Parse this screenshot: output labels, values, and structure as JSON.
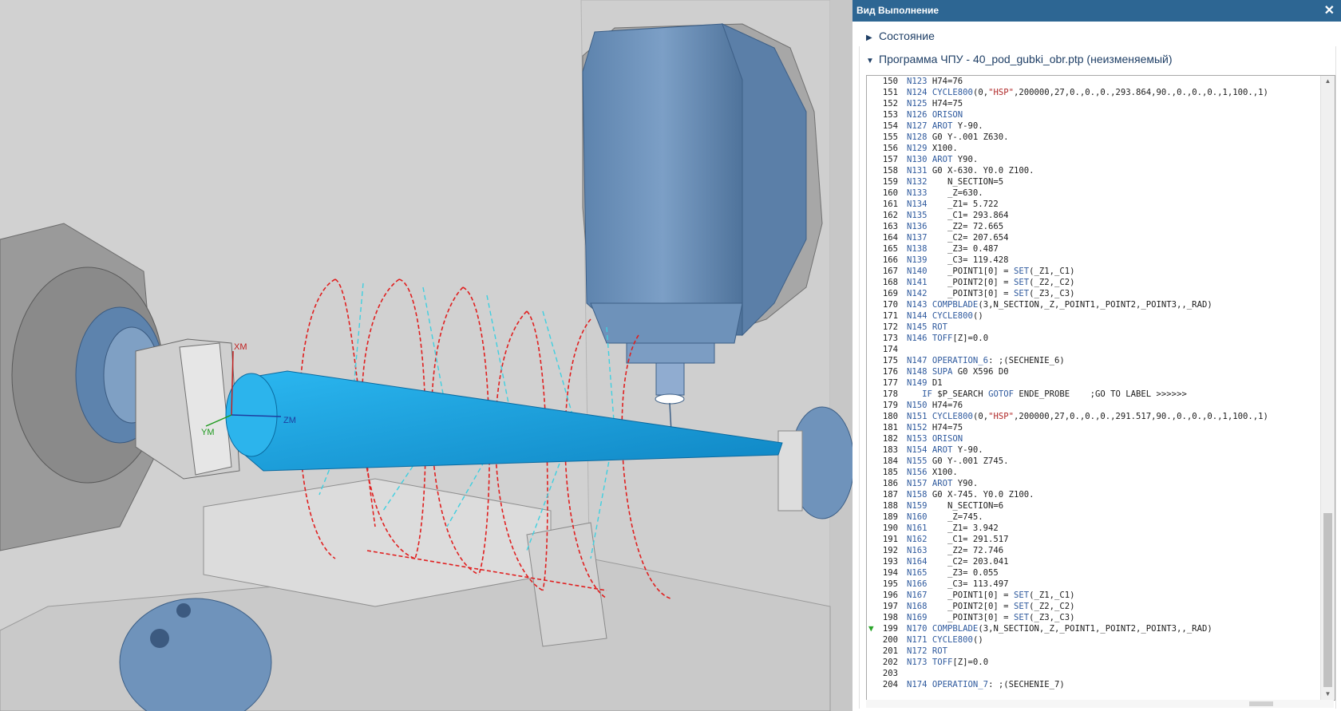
{
  "panel": {
    "title": "Вид Выполнение",
    "close_glyph": "✕",
    "sections": [
      {
        "label": "Состояние",
        "expanded": false
      },
      {
        "label": "Программа ЧПУ - 40_pod_gubki_obr.ptp (неизменяемый)",
        "expanded": true
      }
    ],
    "current_line": "199"
  },
  "viewport": {
    "labels": {
      "xm": "XM",
      "ym": "YM",
      "zm": "ZM"
    }
  },
  "icons": [
    "close-icon",
    "chevron-right-icon",
    "chevron-down-icon",
    "current-line-arrow-icon",
    "scroll-up-icon",
    "scroll-down-icon"
  ],
  "colors": {
    "title_bar": "#2d6693",
    "part": "#1aa3e0",
    "toolpath_red": "#e02020",
    "toolpath_cyan": "#3fd0e0",
    "machine_blue": "#6f93bb"
  },
  "code": [
    {
      "n": "150",
      "text": "N123 H74=76"
    },
    {
      "n": "151",
      "text": "N124 CYCLE800(0,\"HSP\",200000,27,0.,0.,0.,293.864,90.,0.,0.,0.,1,100.,1)"
    },
    {
      "n": "152",
      "text": "N125 H74=75"
    },
    {
      "n": "153",
      "text": "N126 ORISON"
    },
    {
      "n": "154",
      "text": "N127 AROT Y-90."
    },
    {
      "n": "155",
      "text": "N128 G0 Y-.001 Z630."
    },
    {
      "n": "156",
      "text": "N129 X100."
    },
    {
      "n": "157",
      "text": "N130 AROT Y90."
    },
    {
      "n": "158",
      "text": "N131 G0 X-630. Y0.0 Z100."
    },
    {
      "n": "159",
      "text": "N132    N_SECTION=5"
    },
    {
      "n": "160",
      "text": "N133    _Z=630."
    },
    {
      "n": "161",
      "text": "N134    _Z1= 5.722"
    },
    {
      "n": "162",
      "text": "N135    _C1= 293.864"
    },
    {
      "n": "163",
      "text": "N136    _Z2= 72.665"
    },
    {
      "n": "164",
      "text": "N137    _C2= 207.654"
    },
    {
      "n": "165",
      "text": "N138    _Z3= 0.487"
    },
    {
      "n": "166",
      "text": "N139    _C3= 119.428"
    },
    {
      "n": "167",
      "text": "N140    _POINT1[0] = SET(_Z1,_C1)"
    },
    {
      "n": "168",
      "text": "N141    _POINT2[0] = SET(_Z2,_C2)"
    },
    {
      "n": "169",
      "text": "N142    _POINT3[0] = SET(_Z3,_C3)"
    },
    {
      "n": "170",
      "text": "N143 COMPBLADE(3,N_SECTION,_Z,_POINT1,_POINT2,_POINT3,,_RAD)"
    },
    {
      "n": "171",
      "text": "N144 CYCLE800()"
    },
    {
      "n": "172",
      "text": "N145 ROT"
    },
    {
      "n": "173",
      "text": "N146 TOFF[Z]=0.0"
    },
    {
      "n": "174",
      "text": ""
    },
    {
      "n": "175",
      "text": "N147 OPERATION_6: ;(SECHENIE_6)"
    },
    {
      "n": "176",
      "text": "N148 SUPA G0 X596 D0"
    },
    {
      "n": "177",
      "text": "N149 D1"
    },
    {
      "n": "178",
      "text": "   IF $P_SEARCH GOTOF ENDE_PROBE    ;GO TO LABEL >>>>>>"
    },
    {
      "n": "179",
      "text": "N150 H74=76"
    },
    {
      "n": "180",
      "text": "N151 CYCLE800(0,\"HSP\",200000,27,0.,0.,0.,291.517,90.,0.,0.,0.,1,100.,1)"
    },
    {
      "n": "181",
      "text": "N152 H74=75"
    },
    {
      "n": "182",
      "text": "N153 ORISON"
    },
    {
      "n": "183",
      "text": "N154 AROT Y-90."
    },
    {
      "n": "184",
      "text": "N155 G0 Y-.001 Z745."
    },
    {
      "n": "185",
      "text": "N156 X100."
    },
    {
      "n": "186",
      "text": "N157 AROT Y90."
    },
    {
      "n": "187",
      "text": "N158 G0 X-745. Y0.0 Z100."
    },
    {
      "n": "188",
      "text": "N159    N_SECTION=6"
    },
    {
      "n": "189",
      "text": "N160    _Z=745."
    },
    {
      "n": "190",
      "text": "N161    _Z1= 3.942"
    },
    {
      "n": "191",
      "text": "N162    _C1= 291.517"
    },
    {
      "n": "192",
      "text": "N163    _Z2= 72.746"
    },
    {
      "n": "193",
      "text": "N164    _C2= 203.041"
    },
    {
      "n": "194",
      "text": "N165    _Z3= 0.055"
    },
    {
      "n": "195",
      "text": "N166    _C3= 113.497"
    },
    {
      "n": "196",
      "text": "N167    _POINT1[0] = SET(_Z1,_C1)"
    },
    {
      "n": "197",
      "text": "N168    _POINT2[0] = SET(_Z2,_C2)"
    },
    {
      "n": "198",
      "text": "N169    _POINT3[0] = SET(_Z3,_C3)"
    },
    {
      "n": "199",
      "text": "N170 COMPBLADE(3,N_SECTION,_Z,_POINT1,_POINT2,_POINT3,,_RAD)"
    },
    {
      "n": "200",
      "text": "N171 CYCLE800()"
    },
    {
      "n": "201",
      "text": "N172 ROT"
    },
    {
      "n": "202",
      "text": "N173 TOFF[Z]=0.0"
    },
    {
      "n": "203",
      "text": ""
    },
    {
      "n": "204",
      "text": "N174 OPERATION_7: ;(SECHENIE_7)"
    }
  ]
}
